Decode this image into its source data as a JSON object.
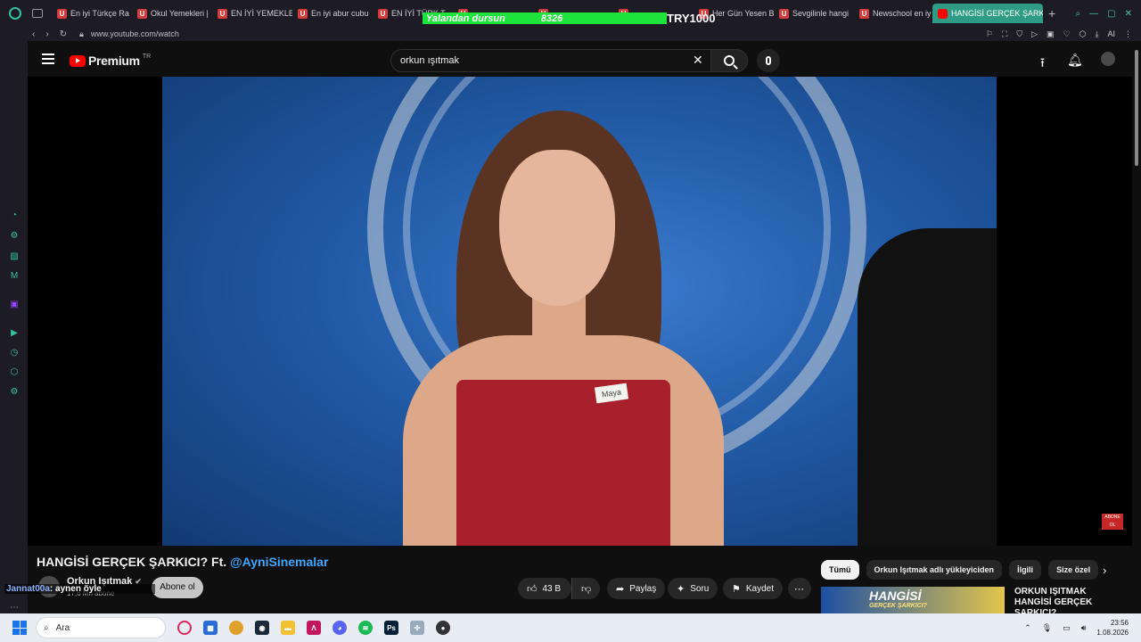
{
  "browser": {
    "tabs": [
      {
        "label": "En iyi Türkçe Ra",
        "fav": "U"
      },
      {
        "label": "Okul Yemekleri |",
        "fav": "U"
      },
      {
        "label": "EN İYİ YEMEKLE",
        "fav": "U"
      },
      {
        "label": "En iyi abur cubu",
        "fav": "U"
      },
      {
        "label": "EN İYİ TÜRK T",
        "fav": "U"
      },
      {
        "label": "",
        "fav": "U"
      },
      {
        "label": "",
        "fav": "U"
      },
      {
        "label": "",
        "fav": "U"
      },
      {
        "label": "Her Gün Yesen B",
        "fav": "U"
      },
      {
        "label": "Sevgilinle hangi",
        "fav": "U"
      },
      {
        "label": "Newschool en iy",
        "fav": "U"
      }
    ],
    "active_tab": "HANGİSİ GERÇEK ŞARKICI",
    "url": "www.youtube.com/watch",
    "ext_label": "AI"
  },
  "overlay": {
    "text": "Yalandan dursun",
    "number": "8326",
    "currency": "TRY1000"
  },
  "youtube": {
    "brand": "Premium",
    "country": "TR",
    "search_value": "orkun ışıtmak"
  },
  "video": {
    "name_tag": "Maya",
    "corner_badge": "ABONE OL",
    "title_main": "HANGİSİ GERÇEK ŞARKICI? Ft.",
    "title_mention": "@AyniSinemalar",
    "channel_name": "Orkun Işıtmak",
    "subscribers": "17,6 Mn abone",
    "subscribe_label": "Abone ol",
    "likes": "43 B",
    "share_label": "Paylaş",
    "ask_label": "Soru",
    "save_label": "Kaydet"
  },
  "chat_overlay": {
    "user": "Jannat00a",
    "message": ": aynen öyle"
  },
  "recommendations": {
    "chips": [
      "Tümü",
      "Orkun Işıtmak adlı yükleyiciden",
      "İlgili",
      "Size özel"
    ],
    "first_thumb_text": "HANGİSİ",
    "first_thumb_sub": "GERÇEK ŞARKICI?",
    "first_title": "ORKUN IŞITMAK HANGİSİ GERÇEK ŞARKICI?"
  },
  "taskbar": {
    "search_placeholder": "Ara",
    "time": "23:56",
    "date": "1.08.2026"
  },
  "colors": {
    "accent": "#2e9c84",
    "youtube_red": "#ff0000",
    "mention_blue": "#3ea6ff",
    "overlay_green": "#1ee33a"
  }
}
